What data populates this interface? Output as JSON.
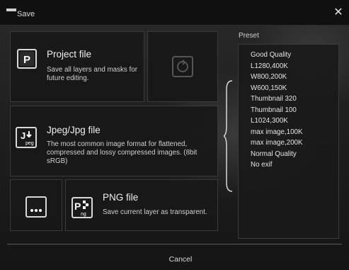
{
  "dialog": {
    "title": "Save",
    "close_glyph": "✕"
  },
  "options": {
    "project": {
      "title": "Project file",
      "description": "Save all layers and masks for future editing.",
      "icon": "project-file-icon"
    },
    "jpeg": {
      "title": "Jpeg/Jpg file",
      "description": "The most common image format for flattened, compressed and lossy compressed images. (8bit sRGB)",
      "icon": "jpeg-file-icon"
    },
    "png": {
      "title": "PNG file",
      "description": "Save current layer as transparent.",
      "icon": "png-file-icon"
    },
    "cloud_icon": "cloud-sync-icon",
    "more_icon": "more-options-icon"
  },
  "preset": {
    "label": "Preset",
    "items": [
      "Good Quality",
      "L1280,400K",
      "W800,200K",
      "W600,150K",
      "Thumbnail 320",
      "Thumbnail 100",
      "L1024,300K",
      "max image,100K",
      "max image,200K",
      "Normal Quality",
      "No exif"
    ]
  },
  "footer": {
    "cancel_label": "Cancel"
  }
}
